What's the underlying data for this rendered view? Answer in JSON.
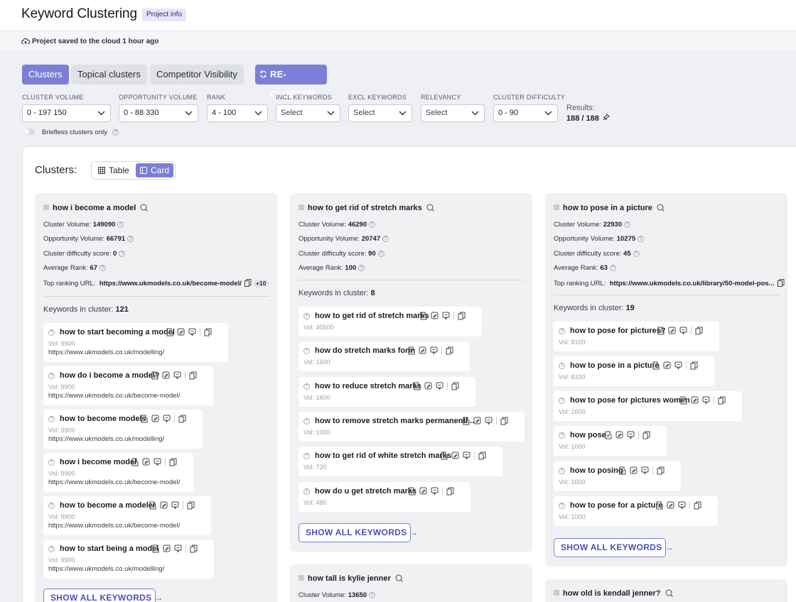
{
  "header": {
    "title": "Keyword Clustering",
    "project_info": "Project info"
  },
  "save_status": "Project saved to the cloud 1 hour ago",
  "tabs": [
    {
      "label": "Clusters",
      "active": true
    },
    {
      "label": "Topical clusters",
      "active": false
    },
    {
      "label": "Competitor Visibility",
      "active": false
    }
  ],
  "recluster_label": "RE-CLUSTER",
  "filters": [
    {
      "label": "CLUSTER VOLUME",
      "value": "0 - 197 150"
    },
    {
      "label": "OPPORTUNITY VOLUME",
      "value": "0 - 88 330"
    },
    {
      "label": "RANK",
      "value": "4 - 100"
    },
    {
      "label": "INCL KEYWORDS",
      "value": "Select"
    },
    {
      "label": "EXCL KEYWORDS",
      "value": "Select"
    },
    {
      "label": "RELEVANCY",
      "value": "Select"
    },
    {
      "label": "CLUSTER DIFFICULTY",
      "value": "0 - 90"
    }
  ],
  "results": {
    "label": "Results:",
    "value": "188 / 188"
  },
  "briefless_label": "Briefless clusters only",
  "clusters_title": "Clusters:",
  "view": {
    "table": "Table",
    "card": "Card",
    "active": "Card"
  },
  "stat_labels": {
    "cluster_volume": "Cluster Volume:",
    "opportunity_volume": "Opportunity Volume:",
    "difficulty": "Cluster difficulty score:",
    "rank": "Average Rank:",
    "top_url": "Top ranking URL:",
    "keywords": "Keywords in cluster:",
    "vol": "Vol:"
  },
  "show_all_label": "SHOW ALL KEYWORDS",
  "clusters": [
    {
      "name": "how i become a model",
      "cluster_volume": "149090",
      "opportunity_volume": "66791",
      "difficulty": "0",
      "rank": "67",
      "top_url": "https://www.ukmodels.co.uk/become-model/",
      "more_urls": "+10",
      "keyword_count": "121",
      "keywords": [
        {
          "name": "how to start becoming a model",
          "vol": "9900",
          "url": "https://www.ukmodels.co.uk/modelling/"
        },
        {
          "name": "how do i become a model?",
          "vol": "9900",
          "url": "https://www.ukmodels.co.uk/become-model/"
        },
        {
          "name": "how to become models",
          "vol": "9900",
          "url": "https://www.ukmodels.co.uk/modelling/"
        },
        {
          "name": "how i become model",
          "vol": "9900",
          "url": "https://www.ukmodels.co.uk/become-model/"
        },
        {
          "name": "how to become a modeler",
          "vol": "9900",
          "url": "https://www.ukmodels.co.uk/become-model/"
        },
        {
          "name": "how to start being a model",
          "vol": "9900",
          "url": "https://www.ukmodels.co.uk/modelling/"
        }
      ]
    },
    {
      "name": "how to get rid of stretch marks",
      "cluster_volume": "46290",
      "opportunity_volume": "20747",
      "difficulty": "90",
      "rank": "100",
      "keyword_count": "8",
      "keywords": [
        {
          "name": "how to get rid of stretch marks",
          "vol": "40500"
        },
        {
          "name": "how do stretch marks form",
          "vol": "1600"
        },
        {
          "name": "how to reduce stretch marks",
          "vol": "1600"
        },
        {
          "name": "how to remove stretch marks permanentl...",
          "vol": "1000"
        },
        {
          "name": "how to get rid of white stretch marks",
          "vol": "720"
        },
        {
          "name": "how do u get stretch marks",
          "vol": "480"
        }
      ]
    },
    {
      "name": "how to pose in a picture",
      "cluster_volume": "22930",
      "opportunity_volume": "10275",
      "difficulty": "45",
      "rank": "63",
      "top_url": "https://www.ukmodels.co.uk/library/50-model-pos...",
      "keyword_count": "19",
      "keywords": [
        {
          "name": "how to pose for pictures?",
          "vol": "8100"
        },
        {
          "name": "how to pose in a picture",
          "vol": "8100"
        },
        {
          "name": "how to pose for pictures women",
          "vol": "1600"
        },
        {
          "name": "how pose",
          "vol": "1600"
        },
        {
          "name": "how to posing",
          "vol": "1600"
        },
        {
          "name": "how to pose for a picture",
          "vol": "1000"
        }
      ]
    },
    {
      "name": "how tall is kylie jenner",
      "cluster_volume": "13650"
    },
    {
      "name": "how old is kendall jenner?"
    }
  ]
}
